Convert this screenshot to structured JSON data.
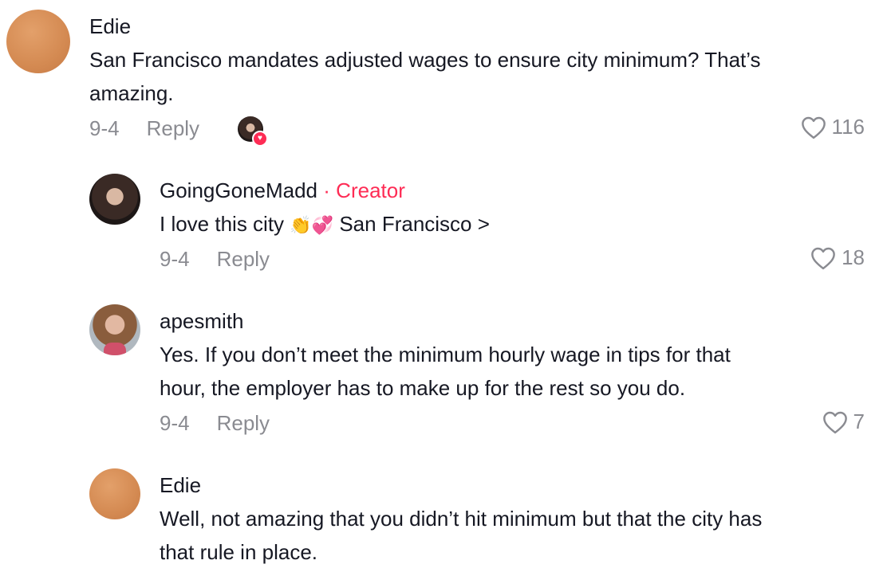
{
  "comments": [
    {
      "username": "Edie",
      "text_line1": "San Francisco mandates adjusted wages to ensure city minimum? That’s",
      "text_line2": "amazing.",
      "date": "9-4",
      "reply_label": "Reply",
      "likes": "116",
      "avatar_icon": "orange-avatar",
      "liked_by_creator": true
    },
    {
      "username": "GoingGoneMadd",
      "badge_separator": "·",
      "badge": "Creator",
      "text_prefix": "I love this city",
      "emojis": "👏💞",
      "text_suffix": "San Francisco >",
      "date": "9-4",
      "reply_label": "Reply",
      "likes": "18"
    },
    {
      "username": "apesmith",
      "text_line1": "Yes. If you don’t meet the minimum hourly wage in tips for that",
      "text_line2": "hour, the employer has to make up for the rest so you do.",
      "date": "9-4",
      "reply_label": "Reply",
      "likes": "7"
    },
    {
      "username": "Edie",
      "text_line1": "Well, not amazing that you didn’t hit minimum but that the city has",
      "text_line2": "that rule in place."
    }
  ],
  "colors": {
    "accent": "#fe2c55",
    "muted": "#8a8b91",
    "text": "#161823"
  }
}
